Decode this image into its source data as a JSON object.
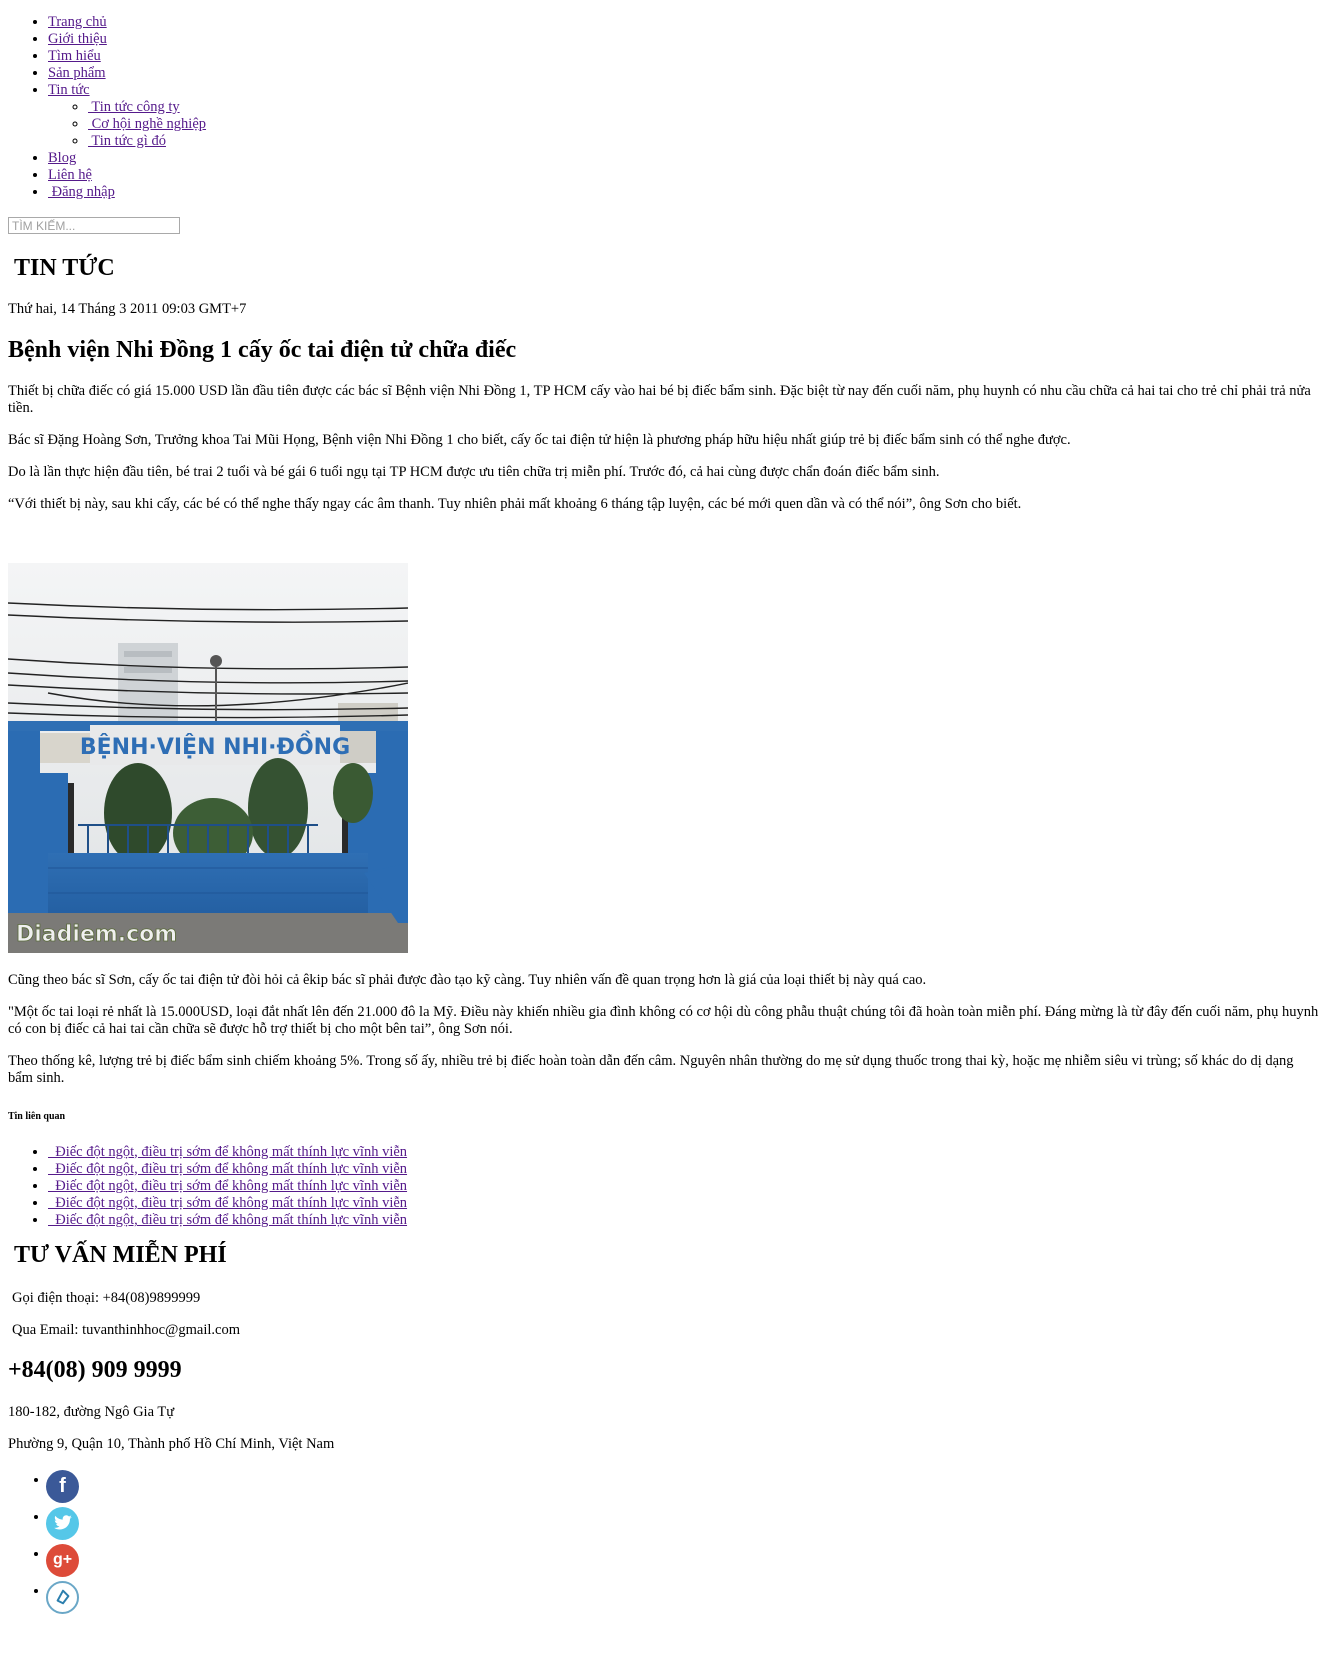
{
  "nav": {
    "items": [
      "Trang chủ",
      "Giới thiệu",
      "Tìm hiểu",
      "Sản phẩm",
      "Tin tức"
    ],
    "sub_items": [
      " Tin tức công ty",
      " Cơ hội nghề nghiệp",
      " Tin tức gì đó"
    ],
    "blog": "Blog",
    "contact": "Liên hệ",
    "login": " Đăng nhập"
  },
  "search": {
    "placeholder": "TÌM KIẾM..."
  },
  "section_title": "TIN TỨC",
  "article": {
    "date": "Thứ hai, 14 Tháng 3 2011 09:03 GMT+7",
    "title": "Bệnh viện Nhi Đồng 1 cấy ốc tai điện tử chữa điếc",
    "paragraphs": [
      "Thiết bị chữa điếc có giá 15.000 USD lần đầu tiên được các bác sĩ Bệnh viện Nhi Đồng 1, TP HCM cấy vào hai bé bị điếc bẩm sinh. Đặc biệt từ nay đến cuối năm, phụ huynh có nhu cầu chữa cả hai tai cho trẻ chỉ phải trả nửa tiền.",
      "Bác sĩ Đặng Hoàng Sơn, Trưởng khoa Tai Mũi Họng, Bệnh viện Nhi Đồng 1 cho biết, cấy ốc tai điện tử hiện là phương pháp hữu hiệu nhất giúp trẻ bị điếc bẩm sinh có thể nghe được.",
      "Do là lần thực hiện đầu tiên, bé trai 2 tuổi và bé gái 6 tuổi ngụ tại TP HCM được ưu tiên chữa trị miễn phí. Trước đó, cả hai cùng được chẩn đoán điếc bẩm sinh.",
      "“Với thiết bị này, sau khi cấy, các bé có thể nghe thấy ngay các âm thanh. Tuy nhiên phải mất khoảng 6 tháng tập luyện, các bé mới quen dần và có thể nói”, ông Sơn cho biết."
    ],
    "photo": {
      "sign_text": "BỆNH·VIỆN NHI·ĐỒNG",
      "watermark": "Diadiem.com"
    },
    "paragraphs_after": [
      "Cũng theo bác sĩ Sơn, cấy ốc tai điện tử đòi hỏi cả êkip bác sĩ phải được đào tạo kỹ càng. Tuy nhiên vấn đề quan trọng hơn là giá của loại thiết bị này quá cao.",
      "\"Một ốc tai loại rẻ nhất là 15.000USD, loại đắt nhất lên đến 21.000 đô la Mỹ. Điều này khiến nhiều gia đình không có cơ hội dù công phẫu thuật chúng tôi đã hoàn toàn miễn phí. Đáng mừng là từ đây đến cuối năm, phụ huynh có con bị điếc cả hai tai cần chữa sẽ được hỗ trợ thiết bị cho một bên tai”, ông Sơn nói.",
      "Theo thống kê, lượng trẻ bị điếc bẩm sinh chiếm khoảng 5%. Trong số ấy, nhiều trẻ bị điếc hoàn toàn dẫn đến câm. Nguyên nhân thường do mẹ sử dụng thuốc trong thai kỳ, hoặc mẹ nhiễm siêu vi trùng; số khác do dị dạng bẩm sinh."
    ]
  },
  "related": {
    "heading": "Tin liên quan",
    "items": [
      "  Điếc đột ngột, điều trị sớm để không mất thính lực vĩnh viễn",
      "  Điếc đột ngột, điều trị sớm để không mất thính lực vĩnh viễn",
      "  Điếc đột ngột, điều trị sớm để không mất thính lực vĩnh viễn",
      "  Điếc đột ngột, điều trị sớm để không mất thính lực vĩnh viễn",
      "  Điếc đột ngột, điều trị sớm để không mất thính lực vĩnh viễn"
    ]
  },
  "consult": {
    "title": "TƯ VẤN MIỄN PHÍ",
    "phone_line": "Gọi điện thoại: +84(08)9899999",
    "email_line": "Qua Email: tuvanthinhhoc@gmail.com"
  },
  "footer": {
    "phone": "+84(08) 909 9999",
    "address1": "180-182, đường Ngô Gia Tự",
    "address2": "Phường 9, Quận 10, Thành phố Hồ Chí Minh, Việt Nam"
  },
  "social": {
    "facebook_glyph": "f",
    "googleplus_glyph": "g+",
    "icons": [
      "facebook-icon",
      "twitter-icon",
      "google-plus-icon",
      "skype-icon"
    ],
    "colors": {
      "facebook": "#3b5998",
      "twitter": "#55c7e8",
      "googleplus": "#dd4b39",
      "other": "#6aa7c7"
    }
  },
  "colors": {
    "link": "#551a8b"
  }
}
